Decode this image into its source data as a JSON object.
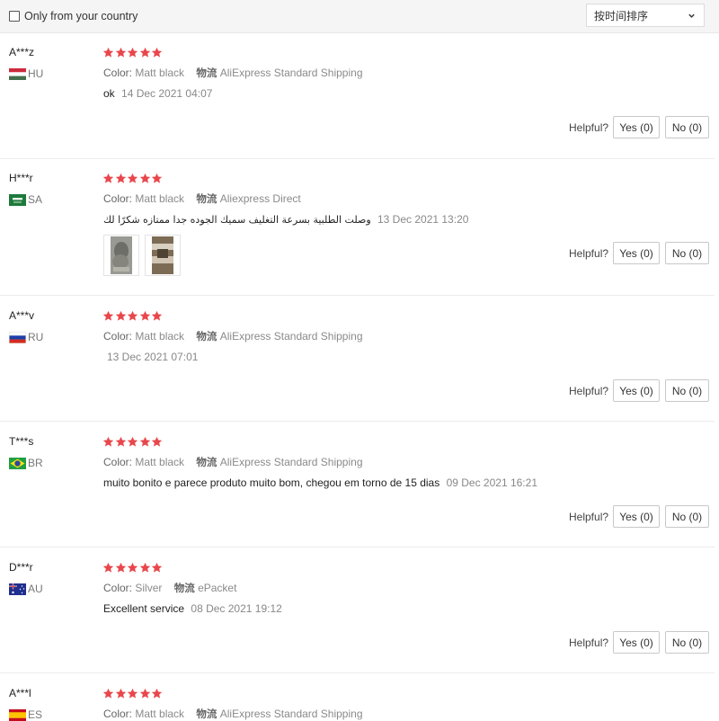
{
  "filter": {
    "label": "Only from your country"
  },
  "sort": {
    "selected": "按时间排序"
  },
  "labels": {
    "color_key": "Color:",
    "shipping_key": "物流",
    "helpful": "Helpful?",
    "yes": "Yes (0)",
    "no": "No (0)"
  },
  "reviews": [
    {
      "user": "A***z",
      "country": "HU",
      "flag_icon": "hungary-flag-icon",
      "stars": 5,
      "color": "Matt black",
      "shipping": "AliExpress Standard Shipping",
      "comment": "ok",
      "date": "14 Dec 2021 04:07",
      "photos": []
    },
    {
      "user": "H***r",
      "country": "SA",
      "flag_icon": "saudi-arabia-flag-icon",
      "stars": 5,
      "color": "Matt black",
      "shipping": "Aliexpress Direct",
      "comment": "وصلت الطلبية بسرعة التغليف سميك الجوده جدا ممتازه شكرًا لك",
      "date": "13 Dec 2021 13:20",
      "photos": [
        "product-photo-1",
        "product-photo-2"
      ]
    },
    {
      "user": "A***v",
      "country": "RU",
      "flag_icon": "russia-flag-icon",
      "stars": 5,
      "color": "Matt black",
      "shipping": "AliExpress Standard Shipping",
      "comment": "",
      "date": "13 Dec 2021 07:01",
      "photos": []
    },
    {
      "user": "T***s",
      "country": "BR",
      "flag_icon": "brazil-flag-icon",
      "stars": 5,
      "color": "Matt black",
      "shipping": "AliExpress Standard Shipping",
      "comment": "muito bonito e parece produto muito bom, chegou em torno de 15 dias",
      "date": "09 Dec 2021 16:21",
      "photos": []
    },
    {
      "user": "D***r",
      "country": "AU",
      "flag_icon": "australia-flag-icon",
      "stars": 5,
      "color": "Silver",
      "shipping": "ePacket",
      "comment": "Excellent service",
      "date": "08 Dec 2021 19:12",
      "photos": []
    },
    {
      "user": "A***l",
      "country": "ES",
      "flag_icon": "spain-flag-icon",
      "stars": 5,
      "color": "Matt black",
      "shipping": "AliExpress Standard Shipping",
      "comment": "",
      "date": "",
      "photos": []
    }
  ],
  "colors": {
    "star": "#e8474c",
    "divider": "#ececec",
    "topbar_bg": "#f5f5f5",
    "meta_text": "#8a8a8a"
  }
}
